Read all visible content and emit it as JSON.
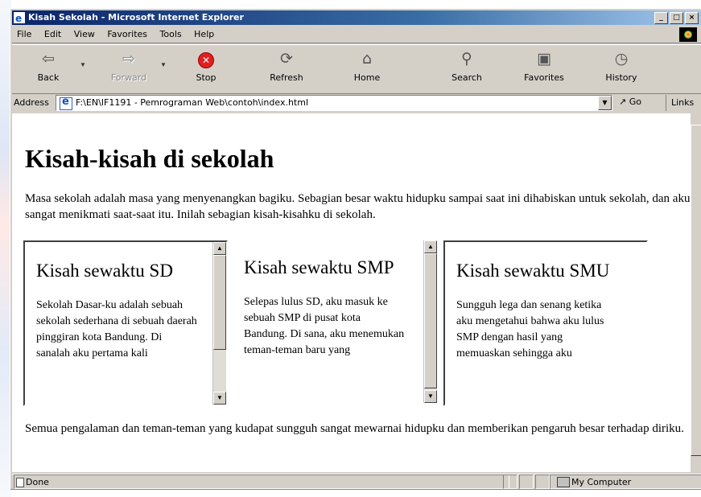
{
  "window": {
    "title": "Kisah Sekolah - Microsoft Internet Explorer",
    "controls": [
      "_",
      "□",
      "×"
    ]
  },
  "menu": {
    "items": [
      "File",
      "Edit",
      "View",
      "Favorites",
      "Tools",
      "Help"
    ]
  },
  "toolbar": {
    "back": "Back",
    "forward": "Forward",
    "stop": "Stop",
    "refresh": "Refresh",
    "home": "Home",
    "search": "Search",
    "favorites": "Favorites",
    "history": "History"
  },
  "address": {
    "label": "Address",
    "value": "F:\\EN\\IF1191 - Pemrograman Web\\contoh\\index.html",
    "go": "Go",
    "links": "Links"
  },
  "page": {
    "heading": "Kisah-kisah di sekolah",
    "intro": "Masa sekolah adalah masa yang menyenangkan bagiku. Sebagian besar waktu hidupku sampai saat ini dihabiskan untuk sekolah, dan aku sangat menikmati saat-saat itu. Inilah sebagian kisah-kisahku di sekolah.",
    "frames": [
      {
        "title": "Kisah sewaktu SD",
        "text": "Sekolah Dasar-ku adalah sebuah sekolah sederhana di sebuah daerah pinggiran kota Bandung. Di sanalah aku pertama kali"
      },
      {
        "title": "Kisah sewaktu SMP",
        "text": "Selepas lulus SD, aku masuk ke sebuah SMP di pusat kota Bandung. Di sana, aku menemukan teman-teman baru yang"
      },
      {
        "title": "Kisah sewaktu SMU",
        "text": "Sungguh lega dan senang ketika aku mengetahui bahwa aku lulus SMP dengan hasil yang memuaskan sehingga aku"
      }
    ],
    "outro": "Semua pengalaman dan teman-teman yang kudapat sungguh sangat mewarnai hidupku dan memberikan pengaruh besar terhadap diriku."
  },
  "status": {
    "text": "Done",
    "zone": "My Computer"
  }
}
